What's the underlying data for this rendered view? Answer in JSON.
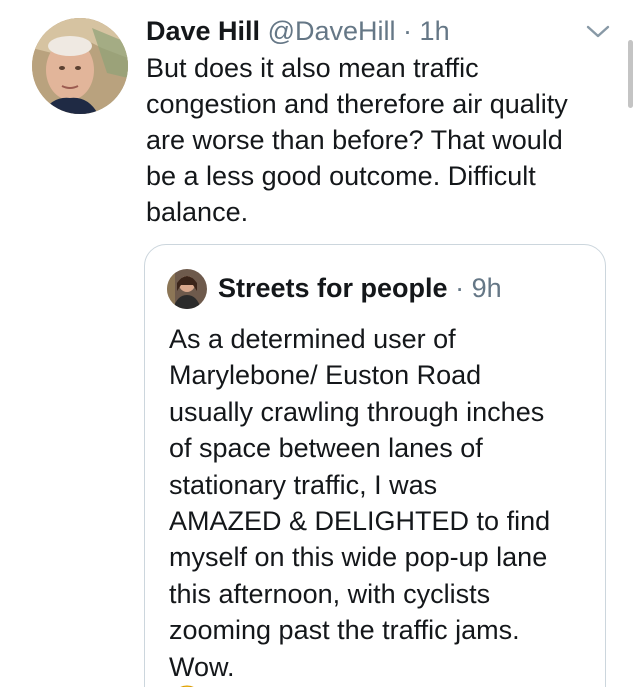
{
  "tweet": {
    "author_name": "Dave Hill",
    "author_handle": "@DaveHill",
    "separator": "·",
    "time": "1h",
    "text_lines": [
      "But does it also mean traffic",
      "congestion and therefore air quality",
      "are worse than before? That would",
      "be a less good outcome. Difficult",
      "balance."
    ]
  },
  "quoted_tweet": {
    "author_name": "Streets for people",
    "separator": "·",
    "time": "9h",
    "text_lines": [
      "As a determined user of",
      "Marylebone/ Euston Road",
      "usually crawling through inches",
      "of space between lanes of",
      "stationary traffic, I was",
      "AMAZED & DELIGHTED to find",
      "myself on this wide pop-up lane",
      "this afternoon, with cyclists",
      "zooming past the traffic jams."
    ],
    "last_line_text": "Wow.",
    "last_line_emoji": "grinning-face-emoji"
  },
  "icons": {
    "menu_caret": "chevron-down-icon"
  },
  "colors": {
    "text_primary": "#14171a",
    "text_secondary": "#657786",
    "card_border": "#ccd6dd"
  }
}
